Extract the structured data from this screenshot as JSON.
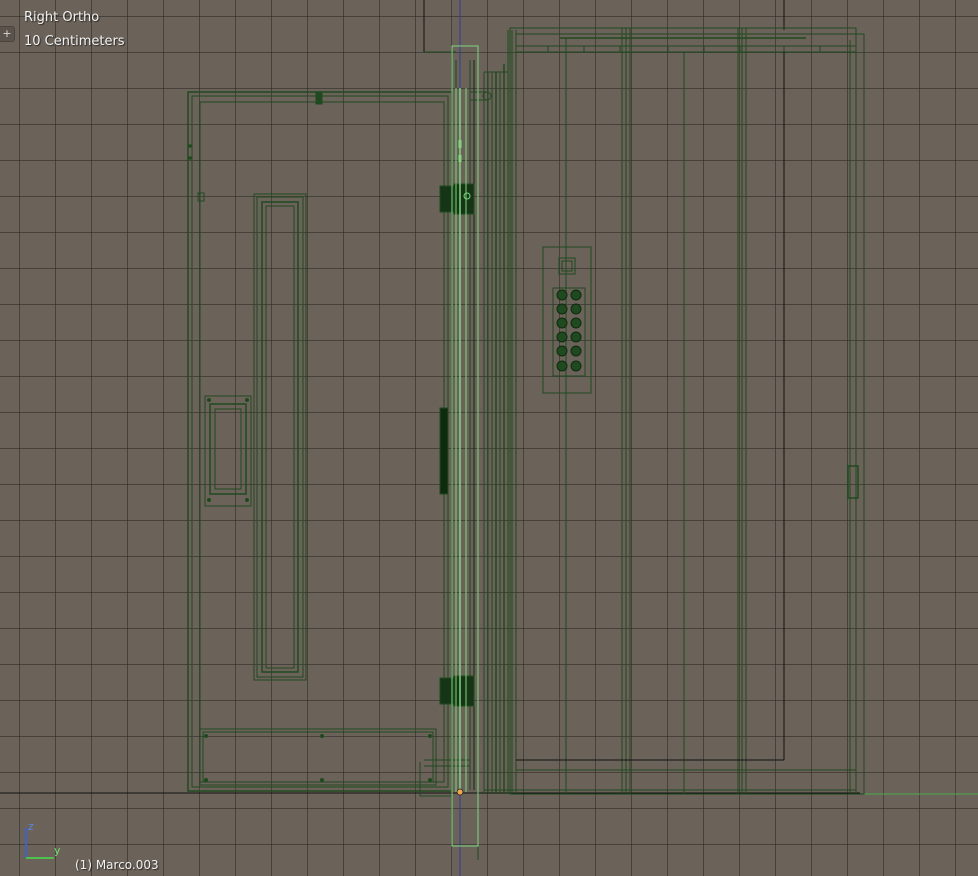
{
  "viewport": {
    "view_name": "Right Ortho",
    "grid_scale": "10 Centimeters",
    "active_object": "(1) Marco.003",
    "toggle_symbol": "+"
  },
  "axis_gizmo": {
    "vertical_label": "z",
    "horizontal_label": "y"
  },
  "colors": {
    "background": "#6b635a",
    "grid_line": "#3e3934",
    "wire": "#1f4a1f",
    "wire_dark": "#0f2a0f",
    "selected_wire": "#7fd67f",
    "axis_z": "#3a64c8",
    "axis_y": "#4fbf4f",
    "origin_dot": "#f0a64a",
    "horizon_line": "#111111"
  },
  "icons": {
    "toggle": "plus-icon",
    "gizmo": "axis-gizmo-icon"
  }
}
